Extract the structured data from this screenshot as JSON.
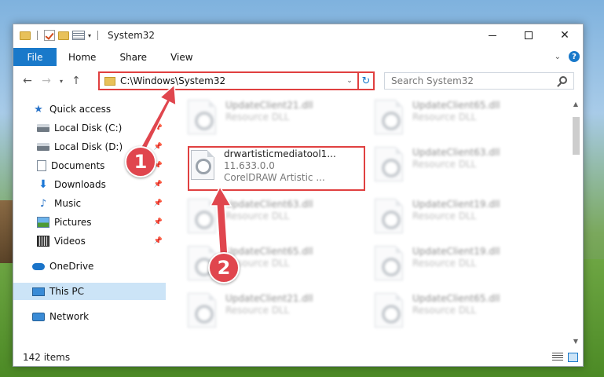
{
  "window": {
    "title": "System32",
    "controls": {
      "minimize": "minimize",
      "maximize": "maximize",
      "close": "✕"
    }
  },
  "ribbon": {
    "tabs": [
      "File",
      "Home",
      "Share",
      "View"
    ]
  },
  "navigation": {
    "address": "C:\\Windows\\System32",
    "search_placeholder": "Search System32"
  },
  "sidebar": {
    "items": [
      {
        "label": "Quick access",
        "icon": "star-icon"
      },
      {
        "label": "Local Disk (C:)",
        "icon": "disk-icon"
      },
      {
        "label": "Local Disk (D:)",
        "icon": "disk-icon"
      },
      {
        "label": "Documents",
        "icon": "documents-icon"
      },
      {
        "label": "Downloads",
        "icon": "downloads-icon"
      },
      {
        "label": "Music",
        "icon": "music-icon"
      },
      {
        "label": "Pictures",
        "icon": "pictures-icon"
      },
      {
        "label": "Videos",
        "icon": "videos-icon"
      },
      {
        "label": "OneDrive",
        "icon": "onedrive-icon"
      },
      {
        "label": "This PC",
        "icon": "pc-icon",
        "selected": true
      },
      {
        "label": "Network",
        "icon": "network-icon"
      }
    ]
  },
  "files": {
    "left": [
      {
        "name": "UpdateClient21.dll",
        "desc": "Resource DLL"
      },
      {
        "name": "UpdateClient63.dll",
        "desc": "Resource DLL"
      },
      {
        "name": "UpdateClient65.dll",
        "desc": "Resource DLL"
      },
      {
        "name": "UpdateClient21.dll",
        "desc": "Resource DLL"
      }
    ],
    "right": [
      {
        "name": "UpdateClient65.dll",
        "desc": "Resource DLL"
      },
      {
        "name": "UpdateClient63.dll",
        "desc": "Resource DLL"
      },
      {
        "name": "UpdateClient19.dll",
        "desc": "Resource DLL"
      },
      {
        "name": "UpdateClient19.dll",
        "desc": "Resource DLL"
      },
      {
        "name": "UpdateClient65.dll",
        "desc": "Resource DLL"
      }
    ],
    "highlighted": {
      "name": "drwartisticmediatool1...",
      "version": "11.633.0.0",
      "desc": "CorelDRAW Artistic ..."
    }
  },
  "status": {
    "item_count": "142 items"
  },
  "callouts": [
    "1",
    "2"
  ],
  "colors": {
    "accent": "#1979ca",
    "highlight_red": "#e04040",
    "callout_red": "#e0464e"
  }
}
